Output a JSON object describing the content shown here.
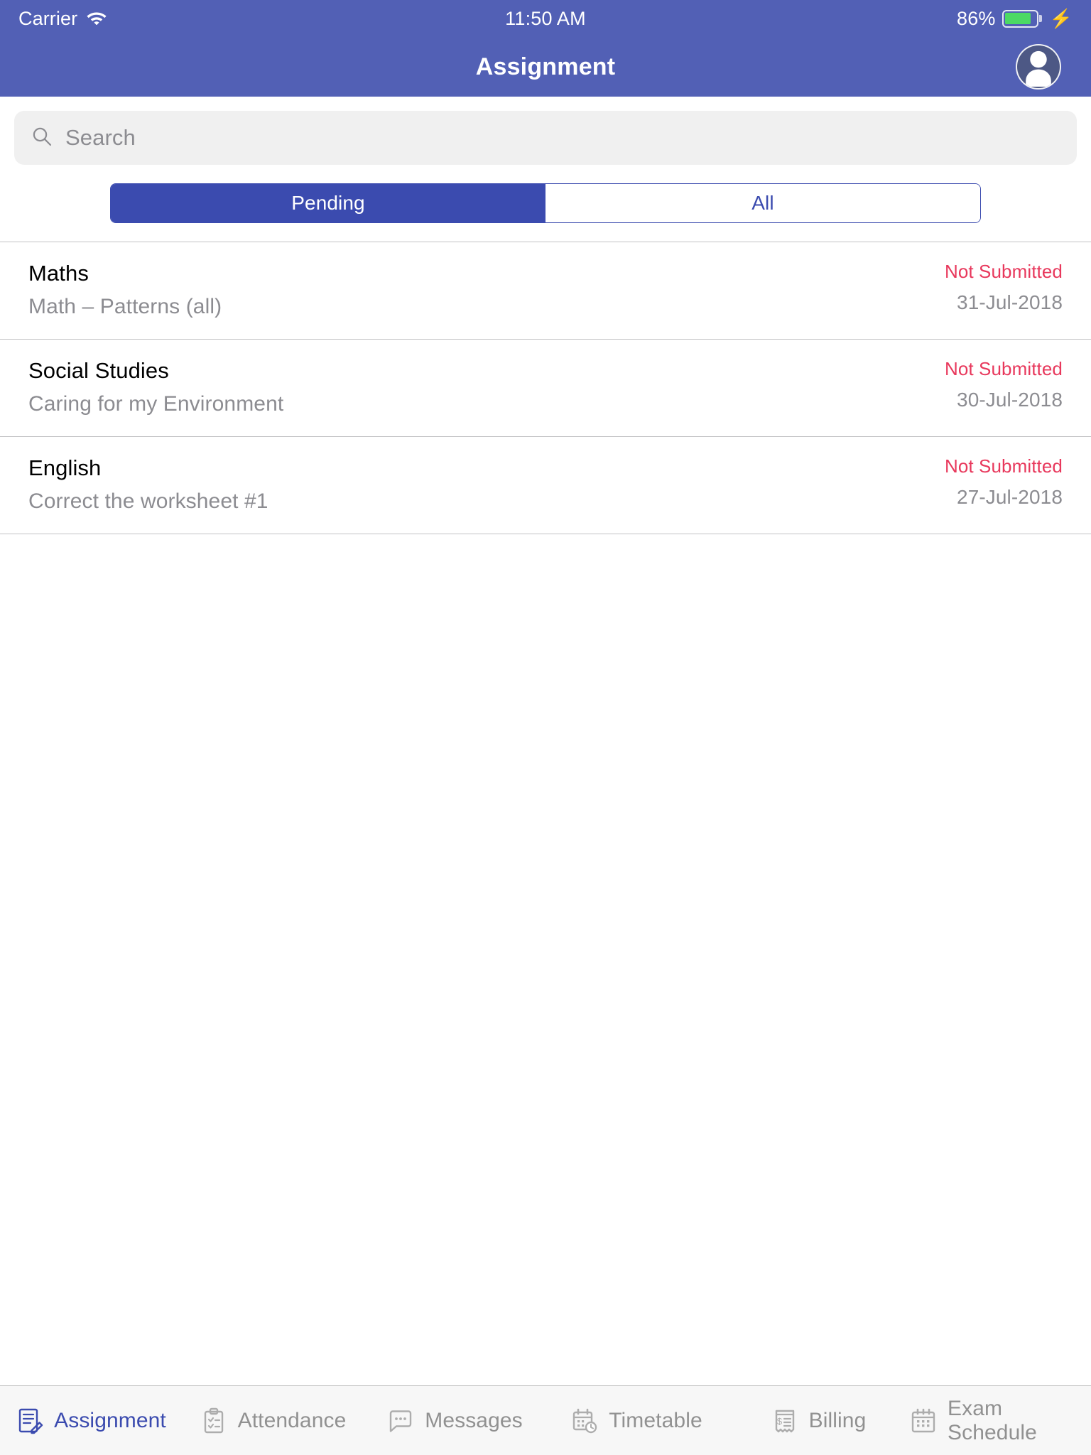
{
  "status_bar": {
    "carrier": "Carrier",
    "wifi_icon": "wifi-icon",
    "time": "11:50 AM",
    "battery_percent": "86%",
    "battery_level": 86,
    "charging_icon": "bolt-icon",
    "battery_fill_color": "#4CD964"
  },
  "nav": {
    "title": "Assignment",
    "avatar_icon": "person-avatar-icon",
    "background_color": "#5260B5"
  },
  "search": {
    "placeholder": "Search",
    "value": "",
    "icon": "search-icon"
  },
  "segmented": {
    "accent_color": "#3B4BAF",
    "options": [
      {
        "label": "Pending",
        "selected": true
      },
      {
        "label": "All",
        "selected": false
      }
    ]
  },
  "list": {
    "status_color": "#E8385C",
    "items": [
      {
        "subject": "Maths",
        "description": "Math – Patterns (all)",
        "status": "Not Submitted",
        "due_date": "31-Jul-2018"
      },
      {
        "subject": "Social Studies",
        "description": "Caring for my Environment",
        "status": "Not Submitted",
        "due_date": "30-Jul-2018"
      },
      {
        "subject": "English",
        "description": "Correct the worksheet #1",
        "status": "Not Submitted",
        "due_date": "27-Jul-2018"
      }
    ]
  },
  "tabbar": {
    "active_color": "#3B4BAF",
    "inactive_color": "#919191",
    "tabs": [
      {
        "label": "Assignment",
        "icon": "document-pencil-icon",
        "active": true
      },
      {
        "label": "Attendance",
        "icon": "clipboard-check-icon",
        "active": false
      },
      {
        "label": "Messages",
        "icon": "chat-bubble-icon",
        "active": false
      },
      {
        "label": "Timetable",
        "icon": "calendar-clock-icon",
        "active": false
      },
      {
        "label": "Billing",
        "icon": "receipt-dollar-icon",
        "active": false
      },
      {
        "label": "Exam Schedule",
        "icon": "calendar-grid-icon",
        "active": false
      }
    ]
  }
}
